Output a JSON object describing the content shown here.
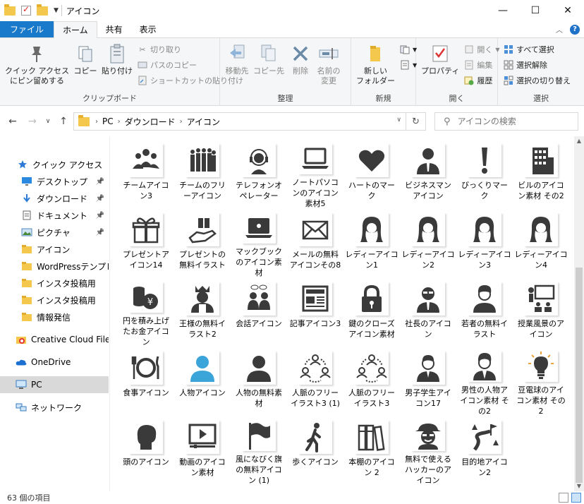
{
  "window": {
    "title": "アイコン"
  },
  "titlebar": {
    "minimize": "—",
    "maximize": "☐",
    "close": "✕"
  },
  "ribbon_tabs": [
    {
      "label": "ファイル"
    },
    {
      "label": "ホーム"
    },
    {
      "label": "共有"
    },
    {
      "label": "表示"
    }
  ],
  "ribbon": {
    "clipboard": {
      "label": "クリップボード",
      "pin": "クイック アクセス\nにピン留めする",
      "copy": "コピー",
      "paste": "貼り付け",
      "cut": "切り取り",
      "copy_path": "パスのコピー",
      "paste_shortcut": "ショートカットの貼り付け"
    },
    "organize": {
      "label": "整理",
      "move_to": "移動先",
      "copy_to": "コピー先",
      "delete": "削除",
      "rename": "名前の\n変更"
    },
    "new": {
      "label": "新規",
      "new_folder": "新しい\nフォルダー"
    },
    "open": {
      "label": "開く",
      "properties": "プロパティ",
      "open": "開く",
      "edit": "編集",
      "history": "履歴"
    },
    "select": {
      "label": "選択",
      "select_all": "すべて選択",
      "select_none": "選択解除",
      "invert": "選択の切り替え"
    }
  },
  "address": {
    "crumbs": [
      "PC",
      "ダウンロード",
      "アイコン"
    ],
    "search_placeholder": "アイコンの検索"
  },
  "navpane": {
    "items": [
      {
        "label": "クイック アクセス",
        "icon": "star-icon",
        "pinned": false
      },
      {
        "label": "デスクトップ",
        "icon": "desktop-icon",
        "pinned": true
      },
      {
        "label": "ダウンロード",
        "icon": "download-icon",
        "pinned": true
      },
      {
        "label": "ドキュメント",
        "icon": "document-icon",
        "pinned": true
      },
      {
        "label": "ピクチャ",
        "icon": "pictures-icon",
        "pinned": true
      },
      {
        "label": "アイコン",
        "icon": "folder-icon",
        "pinned": false
      },
      {
        "label": "WordPressテンプレ",
        "icon": "folder-icon",
        "pinned": false
      },
      {
        "label": "インスタ投稿用",
        "icon": "folder-icon",
        "pinned": false
      },
      {
        "label": "インスタ投稿用",
        "icon": "folder-icon",
        "pinned": false
      },
      {
        "label": "情報発信",
        "icon": "folder-icon",
        "pinned": false
      },
      {
        "label": "Creative Cloud Files",
        "icon": "creative-cloud-icon",
        "pinned": false
      },
      {
        "label": "OneDrive",
        "icon": "onedrive-icon",
        "pinned": false
      },
      {
        "label": "PC",
        "icon": "pc-icon",
        "pinned": false
      },
      {
        "label": "ネットワーク",
        "icon": "network-icon",
        "pinned": false
      }
    ]
  },
  "files": [
    {
      "name": "チームアイコン3",
      "icon": "team-icon"
    },
    {
      "name": "チームのフリーアイコン",
      "icon": "crowd-icon"
    },
    {
      "name": "テレフォンオペレーター",
      "icon": "operator-icon"
    },
    {
      "name": "ノートパソコンのアイコン素材5",
      "icon": "laptop-icon"
    },
    {
      "name": "ハートのマーク",
      "icon": "heart-icon"
    },
    {
      "name": "ビジネスマンアイコン",
      "icon": "businessman-icon"
    },
    {
      "name": "びっくりマーク",
      "icon": "exclamation-icon"
    },
    {
      "name": "ビルのアイコン素材 その2",
      "icon": "building-icon"
    },
    {
      "name": "プレゼントアイコン14",
      "icon": "gift-icon"
    },
    {
      "name": "プレゼントの無料イラスト",
      "icon": "gift-hand-icon"
    },
    {
      "name": "マックブックのアイコン素材",
      "icon": "macbook-icon"
    },
    {
      "name": "メールの無料アイコンその8",
      "icon": "mail-icon"
    },
    {
      "name": "レディーアイコン1",
      "icon": "lady-icon"
    },
    {
      "name": "レディーアイコン2",
      "icon": "lady-icon"
    },
    {
      "name": "レディーアイコン3",
      "icon": "lady-icon"
    },
    {
      "name": "レディーアイコン4",
      "icon": "lady-icon"
    },
    {
      "name": "円を積み上げたお金アイコン",
      "icon": "coins-icon"
    },
    {
      "name": "王様の無料イラスト2",
      "icon": "king-icon"
    },
    {
      "name": "会話アイコン",
      "icon": "conversation-icon"
    },
    {
      "name": "記事アイコン3",
      "icon": "article-icon"
    },
    {
      "name": "鍵のクローズアイコン素材",
      "icon": "lock-icon"
    },
    {
      "name": "社長のアイコン",
      "icon": "president-icon"
    },
    {
      "name": "若者の無料イラスト",
      "icon": "youth-icon"
    },
    {
      "name": "授業風景のアイコン",
      "icon": "lesson-icon"
    },
    {
      "name": "食事アイコン",
      "icon": "meal-icon"
    },
    {
      "name": "人物アイコン",
      "icon": "person-blue-icon"
    },
    {
      "name": "人物の無料素材",
      "icon": "person-icon"
    },
    {
      "name": "人脈のフリーイラスト3 (1)",
      "icon": "network-people-icon"
    },
    {
      "name": "人脈のフリーイラスト3",
      "icon": "network-people-icon"
    },
    {
      "name": "男子学生アイコン17",
      "icon": "student-icon"
    },
    {
      "name": "男性の人物アイコン素材 その2",
      "icon": "man-icon"
    },
    {
      "name": "豆電球のアイコン素材 その2",
      "icon": "bulb-icon"
    },
    {
      "name": "頭のアイコン",
      "icon": "head-icon"
    },
    {
      "name": "動画のアイコン素材",
      "icon": "video-icon"
    },
    {
      "name": "風になびく旗の無料アイコン (1)",
      "icon": "flag-icon"
    },
    {
      "name": "歩くアイコン",
      "icon": "walk-icon"
    },
    {
      "name": "本棚のアイコン 2",
      "icon": "bookshelf-icon"
    },
    {
      "name": "無料で使えるハッカーのアイコン",
      "icon": "hacker-icon"
    },
    {
      "name": "目的地アイコン2",
      "icon": "destination-icon"
    }
  ],
  "status": {
    "count": "63 個の項目"
  },
  "colors": {
    "accent": "#1979ca",
    "icon_fill": "#3a3a3a",
    "person_blue": "#3ba4d8",
    "folder": "#f4c84c"
  }
}
